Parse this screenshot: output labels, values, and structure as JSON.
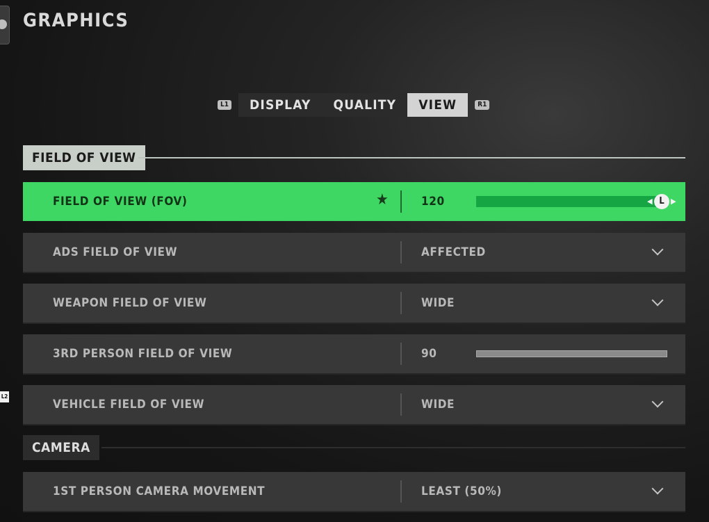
{
  "header": {
    "title": "GRAPHICS"
  },
  "tabs": {
    "left_bumper": "L1",
    "right_bumper": "R1",
    "items": [
      {
        "label": "DISPLAY",
        "active": false
      },
      {
        "label": "QUALITY",
        "active": false
      },
      {
        "label": "VIEW",
        "active": true
      }
    ]
  },
  "sections": {
    "fov": {
      "title": "FIELD OF VIEW",
      "rows": [
        {
          "label": "FIELD OF VIEW (FOV)",
          "value": "120",
          "control": "slider",
          "slider_fraction": 1.0,
          "knob_label": "L",
          "favorite_icon": "star-icon",
          "selected": true
        },
        {
          "label": "ADS FIELD OF VIEW",
          "value": "AFFECTED",
          "control": "dropdown"
        },
        {
          "label": "WEAPON FIELD OF VIEW",
          "value": "WIDE",
          "control": "dropdown"
        },
        {
          "label": "3RD PERSON FIELD OF VIEW",
          "value": "90",
          "control": "slider"
        },
        {
          "label": "VEHICLE FIELD OF VIEW",
          "value": "WIDE",
          "control": "dropdown"
        }
      ]
    },
    "camera": {
      "title": "CAMERA",
      "rows": [
        {
          "label": "1ST PERSON CAMERA MOVEMENT",
          "value": "LEAST (50%)",
          "control": "dropdown"
        }
      ]
    }
  },
  "side_prompt": "L2",
  "colors": {
    "selected_row": "#3fd764",
    "slider_fill": "#15a543",
    "row_bg": "#383838"
  }
}
